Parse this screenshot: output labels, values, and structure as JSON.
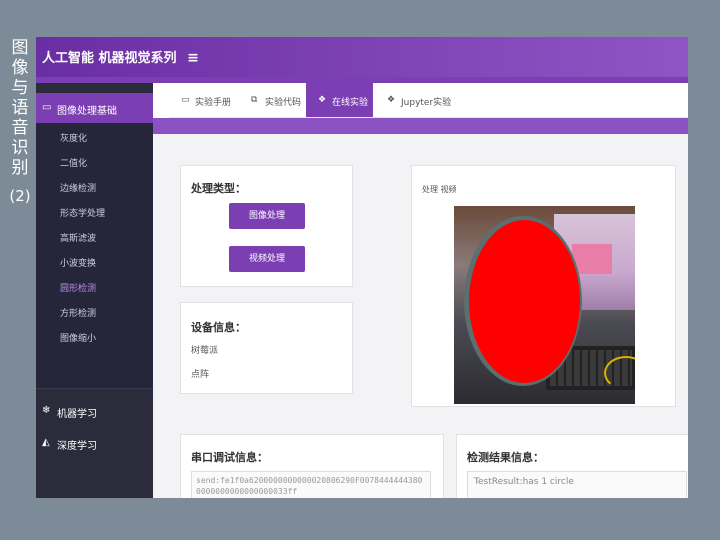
{
  "side_title": {
    "chars": [
      "图",
      "像",
      "与",
      "语",
      "音",
      "识",
      "别"
    ],
    "sub": "(2)"
  },
  "app": {
    "title": "人工智能 机器视觉系列",
    "menu_icon": "hamburger-icon"
  },
  "sidebar": {
    "active_group": {
      "label": "图像处理基础",
      "icon": "monitor-icon"
    },
    "sub_items": [
      "灰度化",
      "二值化",
      "边缘检测",
      "形态学处理",
      "高斯滤波",
      "小波变换",
      "圆形检测",
      "方形检测",
      "图像缩小"
    ],
    "active_sub": "圆形检测",
    "groups": [
      {
        "label": "机器学习",
        "icon": "snowflake-icon"
      },
      {
        "label": "深度学习",
        "icon": "area-chart-icon"
      }
    ]
  },
  "tabs": [
    {
      "label": "实验手册",
      "icon": "monitor-icon"
    },
    {
      "label": "实验代码",
      "icon": "copy-icon"
    },
    {
      "label": "在线实验",
      "icon": "cubes-icon"
    },
    {
      "label": "Jupyter实验",
      "icon": "cubes-icon"
    }
  ],
  "active_tab": "在线实验",
  "process_type": {
    "title": "处理类型：",
    "image_btn": "图像处理",
    "video_btn": "视频处理"
  },
  "device_info": {
    "title": "设备信息：",
    "line1": "树莓派",
    "line2": "点阵"
  },
  "preview": {
    "label": "处理 视频"
  },
  "serial": {
    "title": "串口调试信息：",
    "value": "send:fe1f0a6200000000000020806290F00784444443800000000000000000033ff"
  },
  "result": {
    "title": "检测结果信息：",
    "value": "TestResult:has 1 circle"
  },
  "colors": {
    "accent": "#7b3eb3",
    "sidebar_bg": "#2b2b3c",
    "detect_circle": "#ff0000"
  }
}
